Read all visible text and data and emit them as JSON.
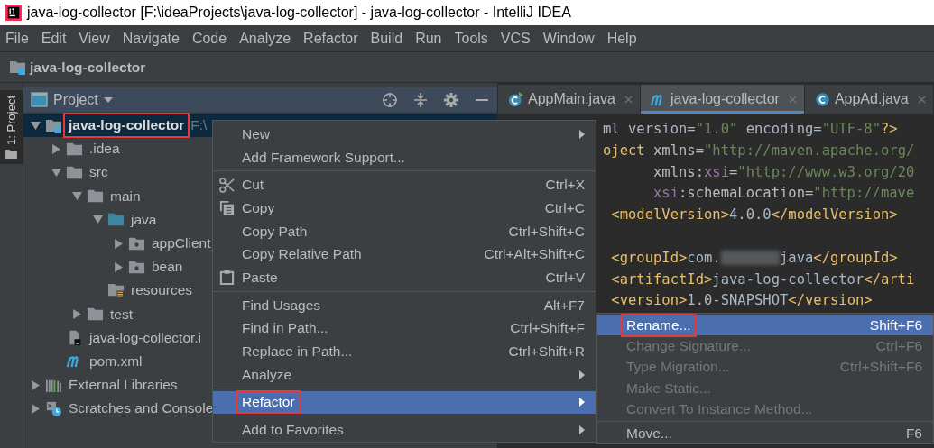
{
  "window": {
    "title": "java-log-collector [F:\\ideaProjects\\java-log-collector] - java-log-collector - IntelliJ IDEA"
  },
  "menu_bar": [
    "File",
    "Edit",
    "View",
    "Navigate",
    "Code",
    "Analyze",
    "Refactor",
    "Build",
    "Run",
    "Tools",
    "VCS",
    "Window",
    "Help"
  ],
  "breadcrumb": {
    "label": "java-log-collector"
  },
  "tool_stripe": {
    "label": "1: Project"
  },
  "project_panel": {
    "title": "Project",
    "tree": [
      {
        "label": "java-log-collector",
        "kind": "module",
        "expanded": true,
        "selected": true,
        "annotated": true,
        "path": "F:\\",
        "children": [
          {
            "label": ".idea",
            "kind": "folder",
            "expanded": false,
            "selected": false
          },
          {
            "label": "src",
            "kind": "folder",
            "expanded": true,
            "selected": false,
            "children": [
              {
                "label": "main",
                "kind": "folder",
                "expanded": true,
                "selected": false,
                "children": [
                  {
                    "label": "java",
                    "kind": "source",
                    "expanded": true,
                    "selected": false,
                    "children": [
                      {
                        "label": "appClient",
                        "kind": "package",
                        "expanded": false,
                        "selected": false
                      },
                      {
                        "label": "bean",
                        "kind": "package",
                        "expanded": false,
                        "selected": false
                      }
                    ]
                  },
                  {
                    "label": "resources",
                    "kind": "resources",
                    "selected": false
                  }
                ]
              },
              {
                "label": "test",
                "kind": "folder",
                "expanded": false,
                "selected": false
              }
            ]
          },
          {
            "label": "java-log-collector.i",
            "kind": "iml",
            "selected": false
          },
          {
            "label": "pom.xml",
            "kind": "maven",
            "selected": false
          }
        ]
      },
      {
        "label": "External Libraries",
        "kind": "libraries",
        "expanded": false,
        "selected": false
      },
      {
        "label": "Scratches and Console",
        "kind": "scratches",
        "expanded": false,
        "selected": false
      }
    ]
  },
  "editor_tabs": [
    {
      "label": "AppMain.java",
      "kind": "java-main",
      "selected": false
    },
    {
      "label": "java-log-collector",
      "kind": "maven",
      "selected": true
    },
    {
      "label": "AppAd.java",
      "kind": "java",
      "selected": false
    }
  ],
  "code_lines": [
    {
      "kind": "head",
      "tokens": [
        {
          "kind": "text",
          "text": "ml version="
        },
        {
          "kind": "string",
          "text": "\"1.0\""
        },
        {
          "kind": "text",
          "text": " encoding="
        },
        {
          "kind": "string",
          "text": "\"UTF-8\""
        },
        {
          "kind": "tag",
          "text": "?>"
        }
      ]
    },
    {
      "kind": "head",
      "tokens": [
        {
          "kind": "tag",
          "text": "oject "
        },
        {
          "kind": "attr",
          "text": "xmlns="
        },
        {
          "kind": "string",
          "text": "\"http://maven.apache.org/"
        }
      ]
    },
    {
      "kind": "attr-continuation",
      "tokens": [
        {
          "kind": "attr",
          "text": "xmlns:"
        },
        {
          "kind": "ns",
          "text": "xsi"
        },
        {
          "kind": "attr",
          "text": "="
        },
        {
          "kind": "string",
          "text": "\"http://www.w3.org/20"
        }
      ]
    },
    {
      "kind": "attr-continuation",
      "tokens": [
        {
          "kind": "ns",
          "text": "xsi"
        },
        {
          "kind": "attr",
          "text": ":schemaLocation="
        },
        {
          "kind": "string",
          "text": "\"http://mave"
        }
      ]
    },
    {
      "kind": "child",
      "tokens": [
        {
          "kind": "tag",
          "text": "<modelVersion>"
        },
        {
          "kind": "text",
          "text": "4.0.0"
        },
        {
          "kind": "tag",
          "text": "</modelVersion>"
        }
      ]
    },
    {
      "kind": "blank"
    },
    {
      "kind": "child",
      "tokens": [
        {
          "kind": "tag",
          "text": "<groupId>"
        },
        {
          "kind": "text",
          "text": "com."
        },
        {
          "kind": "blurred"
        },
        {
          "kind": "text",
          "text": "java"
        },
        {
          "kind": "tag",
          "text": "</groupId>"
        }
      ]
    },
    {
      "kind": "child",
      "tokens": [
        {
          "kind": "tag",
          "text": "<artifactId>"
        },
        {
          "kind": "text",
          "text": "java-log-collector"
        },
        {
          "kind": "tag",
          "text": "</arti"
        }
      ]
    },
    {
      "kind": "child",
      "tokens": [
        {
          "kind": "tag",
          "text": "<version>"
        },
        {
          "kind": "text",
          "text": "1.0-SNAPSHOT"
        },
        {
          "kind": "tag",
          "text": "</version>"
        }
      ]
    }
  ],
  "context_menu": [
    {
      "kind": "item",
      "label": "New",
      "submenu": true,
      "selected": false
    },
    {
      "kind": "item",
      "label": "Add Framework Support...",
      "selected": false
    },
    {
      "kind": "separator"
    },
    {
      "kind": "cut",
      "label": "Cut",
      "shortcut": "Ctrl+X",
      "selected": false
    },
    {
      "kind": "copy",
      "label": "Copy",
      "shortcut": "Ctrl+C",
      "selected": false
    },
    {
      "kind": "item",
      "label": "Copy Path",
      "shortcut": "Ctrl+Shift+C",
      "selected": false
    },
    {
      "kind": "item",
      "label": "Copy Relative Path",
      "shortcut": "Ctrl+Alt+Shift+C",
      "selected": false
    },
    {
      "kind": "paste",
      "label": "Paste",
      "shortcut": "Ctrl+V",
      "selected": false
    },
    {
      "kind": "separator"
    },
    {
      "kind": "item",
      "label": "Find Usages",
      "shortcut": "Alt+F7",
      "selected": false
    },
    {
      "kind": "item",
      "label": "Find in Path...",
      "shortcut": "Ctrl+Shift+F",
      "selected": false
    },
    {
      "kind": "item",
      "label": "Replace in Path...",
      "shortcut": "Ctrl+Shift+R",
      "selected": false
    },
    {
      "kind": "item",
      "label": "Analyze",
      "submenu": true,
      "selected": false
    },
    {
      "kind": "separator"
    },
    {
      "kind": "item",
      "label": "Refactor",
      "submenu": true,
      "selected": true,
      "annotated": true
    },
    {
      "kind": "separator"
    },
    {
      "kind": "item",
      "label": "Add to Favorites",
      "submenu": true,
      "selected": false
    }
  ],
  "refactor_submenu": [
    {
      "kind": "item",
      "label": "Rename...",
      "shortcut": "Shift+F6",
      "selected": true,
      "disabled": false,
      "annotated": true
    },
    {
      "kind": "item",
      "label": "Change Signature...",
      "shortcut": "Ctrl+F6",
      "selected": false,
      "disabled": true
    },
    {
      "kind": "item",
      "label": "Type Migration...",
      "shortcut": "Ctrl+Shift+F6",
      "selected": false,
      "disabled": true
    },
    {
      "kind": "item",
      "label": "Make Static...",
      "selected": false,
      "disabled": true
    },
    {
      "kind": "item",
      "label": "Convert To Instance Method...",
      "selected": false,
      "disabled": true
    },
    {
      "kind": "separator"
    },
    {
      "kind": "item",
      "label": "Move...",
      "shortcut": "F6",
      "selected": false,
      "disabled": false
    }
  ]
}
